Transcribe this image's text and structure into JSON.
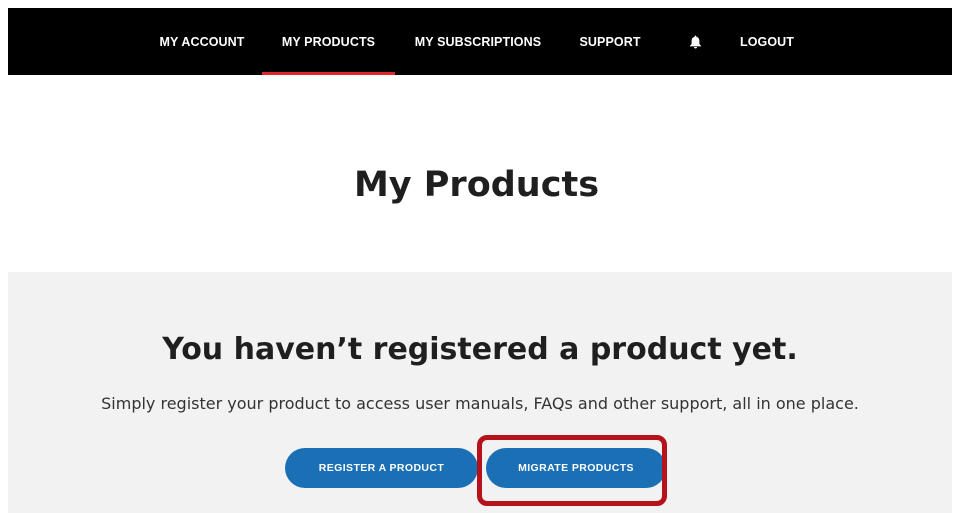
{
  "nav": {
    "items": [
      {
        "label": "MY ACCOUNT",
        "active": false
      },
      {
        "label": "MY PRODUCTS",
        "active": true
      },
      {
        "label": "MY SUBSCRIPTIONS",
        "active": false
      },
      {
        "label": "SUPPORT",
        "active": false
      },
      {
        "label": "",
        "icon": "bell-icon",
        "active": false
      },
      {
        "label": "LOGOUT",
        "active": false
      }
    ],
    "background": "#000000",
    "active_underline_color": "#e0252c"
  },
  "page": {
    "title": "My Products"
  },
  "empty_state": {
    "title": "You haven’t registered a product yet.",
    "description": "Simply register your product to access user manuals, FAQs and other support, all in one place.",
    "buttons": {
      "register_label": "REGISTER A PRODUCT",
      "migrate_label": "MIGRATE PRODUCTS"
    },
    "button_color": "#1a6fb5",
    "panel_background": "#f2f2f2"
  },
  "annotation": {
    "highlight_color": "#b5121b",
    "highlighted_element": "migrate-products-button"
  }
}
